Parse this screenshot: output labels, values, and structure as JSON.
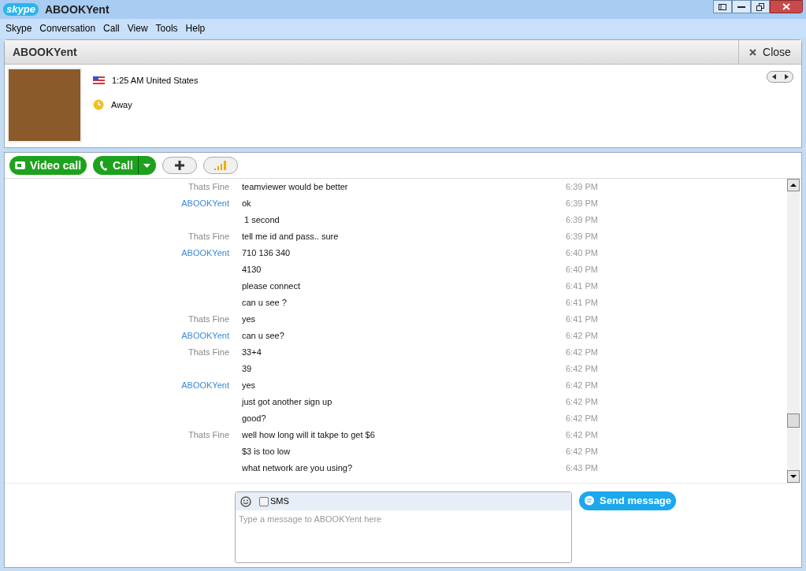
{
  "window": {
    "app": "skype",
    "title": "ABOOKYent"
  },
  "menu": [
    "Skype",
    "Conversation",
    "Call",
    "View",
    "Tools",
    "Help"
  ],
  "contact": {
    "name": "ABOOKYent",
    "close_label": "Close",
    "local_time": "1:25 AM United States",
    "status": "Away"
  },
  "toolbar": {
    "video_call": "Video call",
    "call": "Call"
  },
  "messages": [
    {
      "sender": "Thats Fine",
      "kind": "other",
      "text": "teamviewer would be better",
      "time": "6:39 PM"
    },
    {
      "sender": "ABOOKYent",
      "kind": "contact",
      "text": "ok",
      "time": "6:39 PM"
    },
    {
      "text": " 1 second",
      "time": "6:39 PM"
    },
    {
      "sender": "Thats Fine",
      "kind": "other",
      "text": "tell me id and pass.. sure",
      "time": "6:39 PM"
    },
    {
      "sender": "ABOOKYent",
      "kind": "contact",
      "text": "710 136 340",
      "time": "6:40 PM"
    },
    {
      "text": "4130",
      "time": "6:40 PM"
    },
    {
      "text": "please connect",
      "time": "6:41 PM"
    },
    {
      "text": "can u see ?",
      "time": "6:41 PM"
    },
    {
      "sender": "Thats Fine",
      "kind": "other",
      "text": "yes",
      "time": "6:41 PM"
    },
    {
      "sender": "ABOOKYent",
      "kind": "contact",
      "text": "can u see?",
      "time": "6:42 PM"
    },
    {
      "sender": "Thats Fine",
      "kind": "other",
      "text": "33+4",
      "time": "6:42 PM"
    },
    {
      "text": "39",
      "time": "6:42 PM"
    },
    {
      "sender": "ABOOKYent",
      "kind": "contact",
      "text": "yes",
      "time": "6:42 PM"
    },
    {
      "text": "just got another sign up",
      "time": "6:42 PM"
    },
    {
      "text": "good?",
      "time": "6:42 PM"
    },
    {
      "sender": "Thats Fine",
      "kind": "other",
      "text": "well how long will it takpe to get $6",
      "time": "6:42 PM"
    },
    {
      "text": "$3 is too low",
      "time": "6:42 PM"
    },
    {
      "text": "what network are you using?",
      "time": "6:43 PM"
    }
  ],
  "composer": {
    "sms_label": "SMS",
    "sms_checked": false,
    "placeholder": "Type a message to ABOOKYent here",
    "send_label": "Send message"
  }
}
